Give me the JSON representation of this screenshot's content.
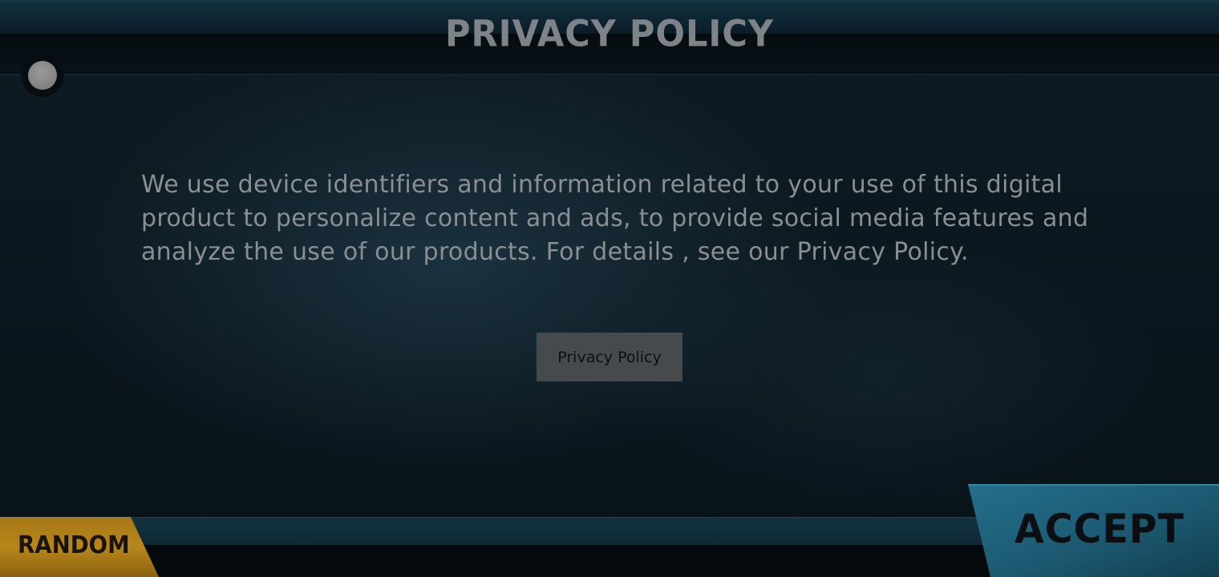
{
  "header": {
    "title": "PRIVACY POLICY"
  },
  "notice": {
    "body": "We use device identifiers and information related to your use of this digital product to personalize content and ads, to provide social media features and analyze the use of our products. For details , see our Privacy Policy."
  },
  "buttons": {
    "privacy_policy_label": "Privacy Policy",
    "random_label": "RANDOM",
    "accept_label": "ACCEPT"
  },
  "colors": {
    "accept_accent": "#1d5f7a",
    "random_accent": "#b8861a",
    "text_gray": "#8a8f91"
  }
}
